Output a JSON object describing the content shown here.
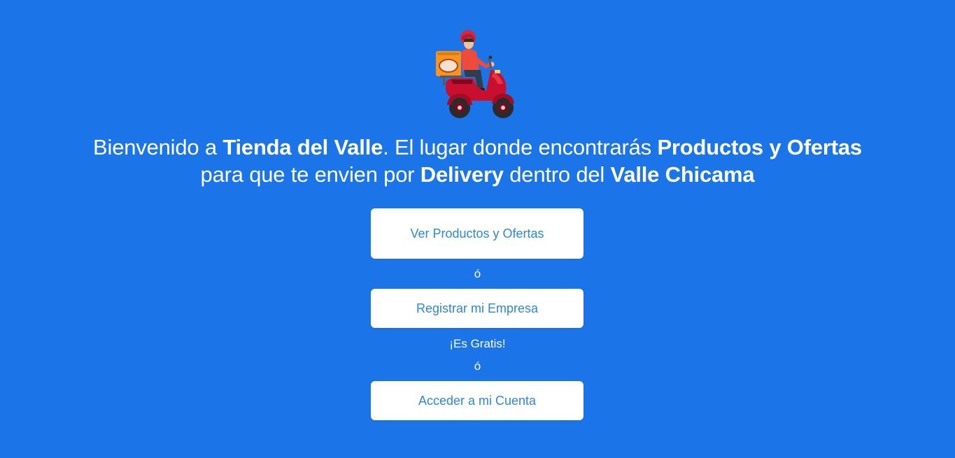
{
  "logo": {
    "icon": "delivery-scooter-icon"
  },
  "headline": {
    "line1_prefix": "Bienvenido a ",
    "store_name": "Tienda del Valle",
    "line1_middle": ". El lugar donde encontrarás ",
    "products_offers": "Productos y Ofertas",
    "line2_prefix": "para que te envien por ",
    "delivery": "Delivery",
    "line2_middle": " dentro del ",
    "region": "Valle Chicama"
  },
  "actions": {
    "products_button": "Ver Productos y Ofertas",
    "separator_1": "ó",
    "register_button": "Registrar mi Empresa",
    "free_note": "¡Es Gratis!",
    "separator_2": "ó",
    "login_button": "Acceder a mi Cuenta"
  },
  "colors": {
    "background": "#1b75e8",
    "button_background": "#ffffff",
    "button_text": "#2e86d6"
  }
}
